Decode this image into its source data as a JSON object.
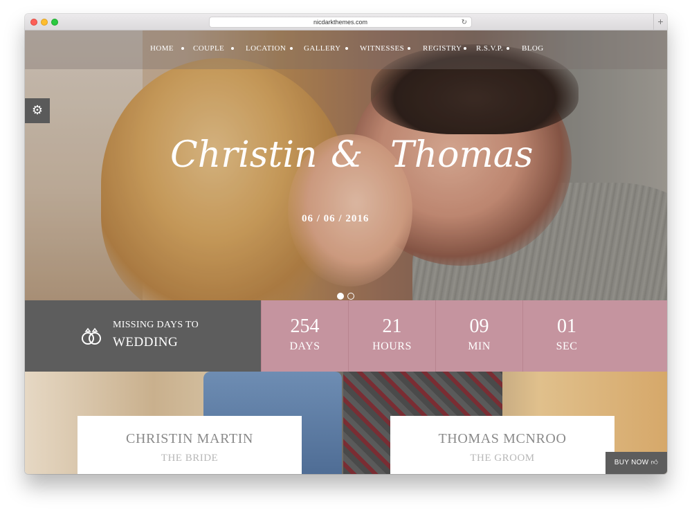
{
  "browser": {
    "url": "nicdarkthemes.com"
  },
  "nav": {
    "items": [
      "HOME",
      "COUPLE",
      "LOCATION",
      "GALLERY",
      "WITNESSES",
      "REGISTRY",
      "R.S.V.P.",
      "BLOG"
    ]
  },
  "hero": {
    "name_left": "Christin",
    "ampersand": "&",
    "name_right": "Thomas",
    "date": "06 / 06 / 2016"
  },
  "countdown": {
    "label_small": "MISSING DAYS TO",
    "label_big": "WEDDING",
    "days": {
      "value": "254",
      "unit": "DAYS"
    },
    "hours": {
      "value": "21",
      "unit": "HOURS"
    },
    "minutes": {
      "value": "09",
      "unit": "MIN"
    },
    "seconds": {
      "value": "01",
      "unit": "SEC"
    }
  },
  "couple": {
    "bride": {
      "name": "CHRISTIN MARTIN",
      "role": "THE BRIDE"
    },
    "groom": {
      "name": "THOMAS MCNROO",
      "role": "THE GROOM"
    }
  },
  "buy_now": {
    "label": "BUY NOW"
  },
  "colors": {
    "accent_pink": "#c5949f",
    "dark_gray": "#5d5d5d"
  }
}
